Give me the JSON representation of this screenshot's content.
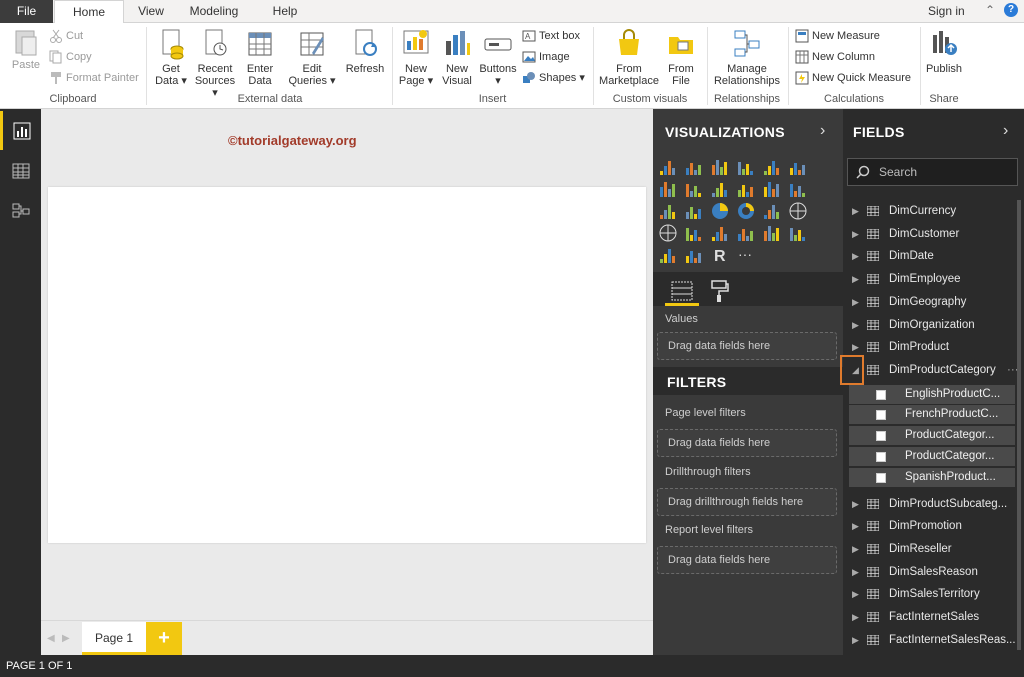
{
  "tabs": {
    "file": "File",
    "home": "Home",
    "view": "View",
    "modeling": "Modeling",
    "help": "Help",
    "signin": "Sign in"
  },
  "ribbon": {
    "clipboard": {
      "paste": "Paste",
      "cut": "Cut",
      "copy": "Copy",
      "format_painter": "Format Painter",
      "label": "Clipboard"
    },
    "external": {
      "get_data_1": "Get",
      "get_data_2": "Data ▾",
      "recent_1": "Recent",
      "recent_2": "Sources ▾",
      "enter_1": "Enter",
      "enter_2": "Data",
      "edit_1": "Edit",
      "edit_2": "Queries ▾",
      "refresh": "Refresh",
      "label": "External data"
    },
    "insert": {
      "new_page_1": "New",
      "new_page_2": "Page ▾",
      "new_visual_1": "New",
      "new_visual_2": "Visual",
      "buttons": "Buttons ▾",
      "text_box": "Text box",
      "image": "Image",
      "shapes": "Shapes ▾",
      "label": "Insert"
    },
    "custom": {
      "marketplace_1": "From",
      "marketplace_2": "Marketplace",
      "file_1": "From",
      "file_2": "File",
      "label": "Custom visuals"
    },
    "relationships": {
      "manage_1": "Manage",
      "manage_2": "Relationships",
      "label": "Relationships"
    },
    "calculations": {
      "new_measure": "New Measure",
      "new_column": "New Column",
      "new_quick_measure": "New Quick Measure",
      "label": "Calculations"
    },
    "share": {
      "publish": "Publish",
      "label": "Share"
    }
  },
  "canvas": {
    "watermark": "©tutorialgateway.org",
    "page_tab": "Page 1",
    "add_page": "+"
  },
  "status": "PAGE 1 OF 1",
  "visualizations": {
    "title": "VISUALIZATIONS",
    "values_label": "Values",
    "drop_values": "Drag data fields here"
  },
  "filters": {
    "title": "FILTERS",
    "page_level": "Page level filters",
    "drop_page": "Drag data fields here",
    "drillthrough": "Drillthrough filters",
    "drop_drill": "Drag drillthrough fields here",
    "report_level": "Report level filters",
    "drop_report": "Drag data fields here"
  },
  "fields": {
    "title": "FIELDS",
    "search_placeholder": "Search",
    "tables": [
      "DimCurrency",
      "DimCustomer",
      "DimDate",
      "DimEmployee",
      "DimGeography",
      "DimOrganization",
      "DimProduct",
      "DimProductCategory"
    ],
    "expanded_columns": [
      "EnglishProductC...",
      "FrenchProductC...",
      "ProductCategor...",
      "ProductCategor...",
      "SpanishProduct..."
    ],
    "tables_after": [
      "DimProductSubcateg...",
      "DimPromotion",
      "DimReseller",
      "DimSalesReason",
      "DimSalesTerritory",
      "FactInternetSales",
      "FactInternetSalesReas..."
    ]
  }
}
